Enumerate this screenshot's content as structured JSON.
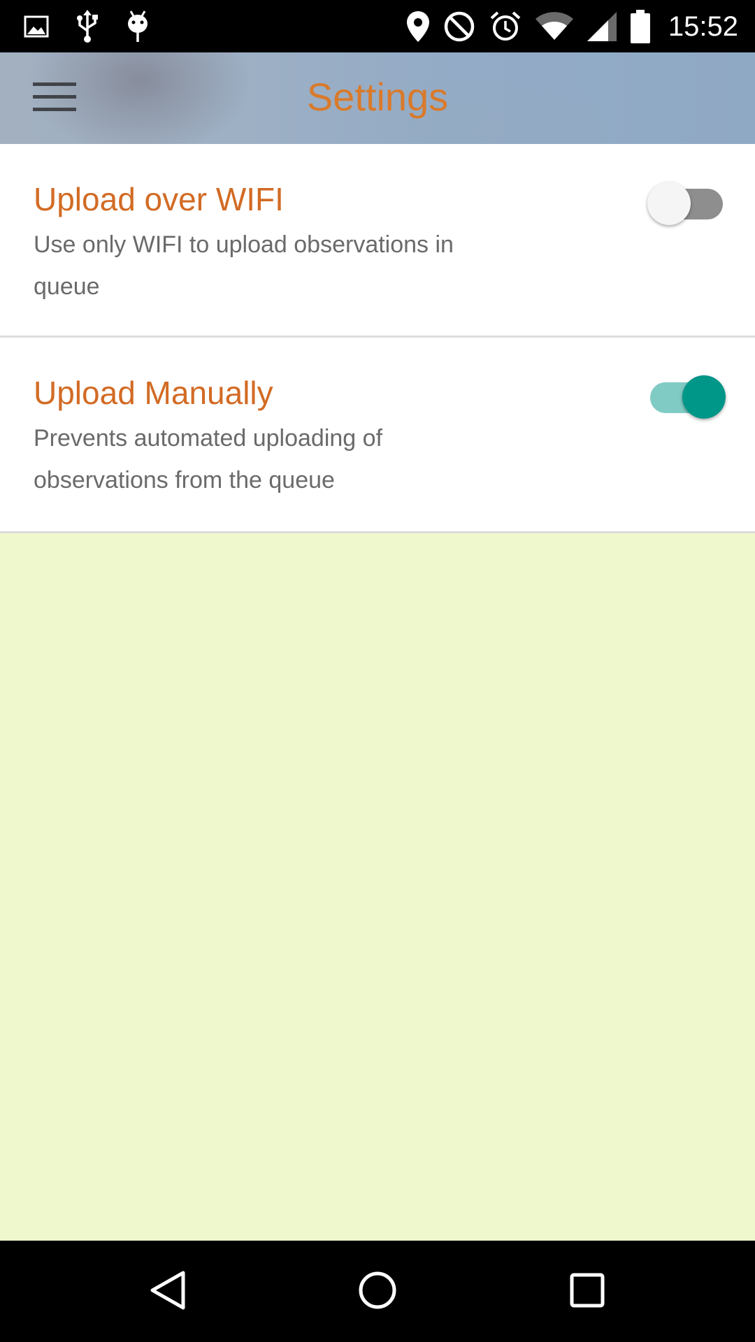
{
  "status_bar": {
    "time": "15:52",
    "left_icons": [
      "image-icon",
      "usb-icon",
      "android-debug-icon"
    ],
    "right_icons": [
      "location-icon",
      "do-not-disturb-icon",
      "alarm-icon",
      "wifi-icon",
      "cellular-signal-icon",
      "battery-icon"
    ]
  },
  "app_bar": {
    "title": "Settings",
    "menu_icon": "hamburger-menu-icon",
    "title_color": "#d97a2b"
  },
  "settings": [
    {
      "title": "Upload over WIFI",
      "summary": "Use only WIFI to upload observations in queue",
      "enabled": false
    },
    {
      "title": "Upload Manually",
      "summary": "Prevents automated uploading of observations from the queue",
      "enabled": true
    }
  ],
  "nav_bar": {
    "buttons": [
      "back-icon",
      "home-icon",
      "recents-icon"
    ]
  },
  "colors": {
    "accent": "#009688",
    "accent_light": "#80cbc4",
    "setting_title": "#d26b24",
    "content_background": "#eef8cc"
  }
}
